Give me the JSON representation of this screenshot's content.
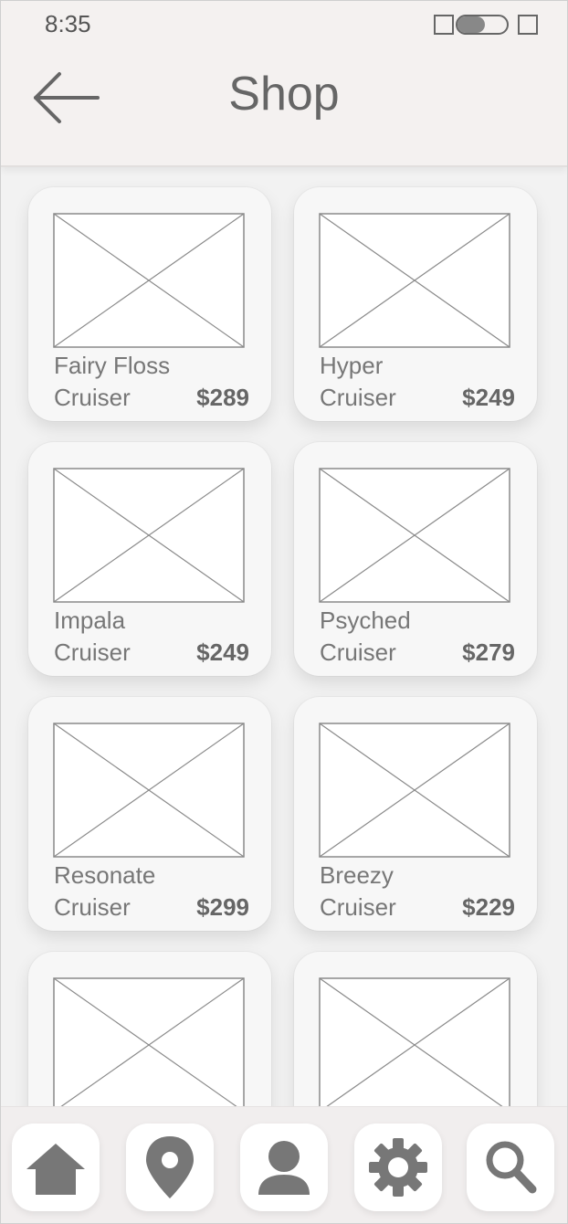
{
  "status_bar": {
    "time": "8:35"
  },
  "header": {
    "title": "Shop",
    "back_icon": "arrow-left-icon"
  },
  "products": [
    {
      "name_line1": "Fairy Floss",
      "name_line2": "Cruiser",
      "price": "$289"
    },
    {
      "name_line1": "Hyper",
      "name_line2": "Cruiser",
      "price": "$249"
    },
    {
      "name_line1": "Impala",
      "name_line2": "Cruiser",
      "price": "$249"
    },
    {
      "name_line1": "Psyched",
      "name_line2": "Cruiser",
      "price": "$279"
    },
    {
      "name_line1": "Resonate",
      "name_line2": "Cruiser",
      "price": "$299"
    },
    {
      "name_line1": "Breezy",
      "name_line2": "Cruiser",
      "price": "$229"
    },
    {
      "name_line1": "",
      "name_line2": "",
      "price": ""
    },
    {
      "name_line1": "",
      "name_line2": "",
      "price": ""
    }
  ],
  "tab_bar": {
    "items": [
      {
        "icon": "home-icon"
      },
      {
        "icon": "map-pin-icon"
      },
      {
        "icon": "user-icon"
      },
      {
        "icon": "gear-icon"
      },
      {
        "icon": "search-icon"
      }
    ]
  },
  "colors": {
    "icon": "#777777",
    "wire": "#8a8a8a",
    "card": "#f7f7f7",
    "header": "#f4f1f0"
  }
}
